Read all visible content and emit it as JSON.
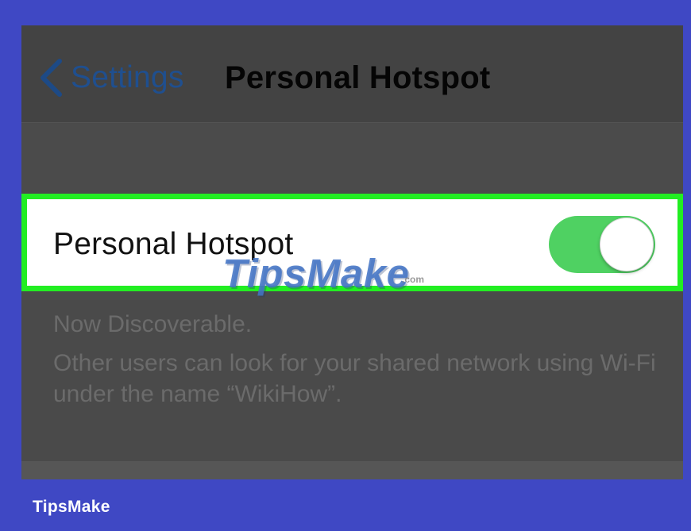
{
  "navigation": {
    "back_label": "Settings",
    "title": "Personal Hotspot"
  },
  "hotspot": {
    "label": "Personal Hotspot",
    "enabled": true,
    "status": "Now Discoverable.",
    "description": "Other users can look for your shared network using Wi-Fi under the name “WikiHow”."
  },
  "watermark": {
    "text": "TipsMake",
    "suffix": ".com"
  },
  "branding": {
    "name": "TipsMake"
  },
  "colors": {
    "background": "#3f48c4",
    "screen": "#4a4a4a",
    "back_blue": "#1f4f8f",
    "highlight_green": "#22ee22",
    "toggle_green": "#4fd162"
  },
  "icons": {
    "back": "chevron-left-icon"
  }
}
